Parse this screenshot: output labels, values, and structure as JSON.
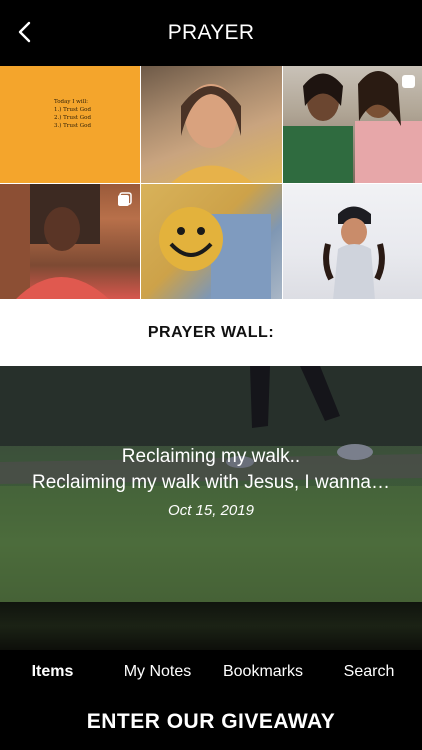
{
  "header": {
    "title": "PRAYER"
  },
  "grid": {
    "note_lines": [
      "Today I will:",
      "1.) Trust God",
      "2.) Trust God",
      "3.) Trust God"
    ]
  },
  "prayer_wall": {
    "title": "PRAYER WALL:"
  },
  "feature": {
    "title": "Reclaiming my walk..",
    "body": "Reclaiming my walk with Jesus, I wanna…",
    "date": "Oct 15, 2019"
  },
  "tabs": [
    {
      "label": "Items"
    },
    {
      "label": "My Notes"
    },
    {
      "label": "Bookmarks"
    },
    {
      "label": "Search"
    }
  ],
  "giveaway": {
    "label": "ENTER OUR GIVEAWAY"
  },
  "colors": {
    "header_bg": "#000000",
    "wall_bg": "#ffffff",
    "accent_tile": "#f4a52c"
  }
}
